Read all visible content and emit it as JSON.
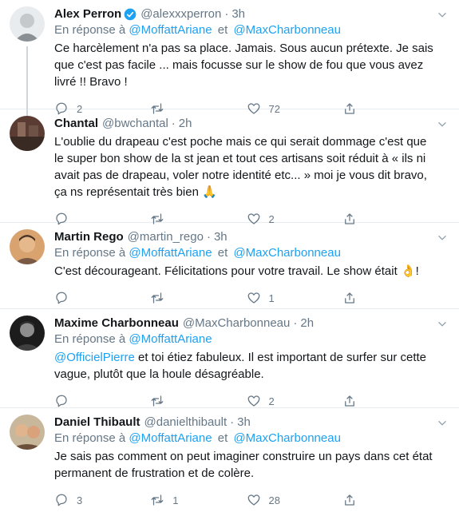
{
  "tweets": [
    {
      "name": "Alex Perron",
      "verified": true,
      "handle": "@alexxxperron",
      "time": "3h",
      "reply_prefix": "En réponse à",
      "reply_to_1": "@MoffattAriane",
      "reply_sep": "et",
      "reply_to_2": "@MaxCharbonneau",
      "text": "Ce harcèlement n'a pas sa place. Jamais. Sous aucun prétexte. Je sais que c'est pas facile ... mais focusse sur le show de fou que vous avez livré !! Bravo !",
      "reply_count": "2",
      "retweet_count": "",
      "like_count": "72"
    },
    {
      "name": "Chantal",
      "handle": "@bwchantal",
      "time": "2h",
      "text": "L'oublie du drapeau c'est poche mais ce qui serait dommage c'est que le super bon show de la st jean et tout ces artisans soit réduit à « ils ni avait pas de drapeau, voler notre identité etc... » moi je vous dit bravo, ça ns représentait très bien",
      "emoji": "🙏",
      "reply_count": "",
      "retweet_count": "",
      "like_count": "2"
    },
    {
      "name": "Martin Rego",
      "handle": "@martin_rego",
      "time": "3h",
      "reply_prefix": "En réponse à",
      "reply_to_1": "@MoffattAriane",
      "reply_sep": "et",
      "reply_to_2": "@MaxCharbonneau",
      "text": "C'est décourageant. Félicitations pour votre travail. Le show était",
      "emoji": "👌",
      "text_end": "!",
      "reply_count": "",
      "retweet_count": "",
      "like_count": "1"
    },
    {
      "name": "Maxime Charbonneau",
      "handle": "@MaxCharbonneau",
      "time": "2h",
      "reply_prefix": "En réponse à",
      "reply_to_1": "@MoffattAriane",
      "mention": "@OfficielPierre",
      "text": "et toi étiez fabuleux. Il est important de surfer sur cette vague, plutôt que la houle désagréable.",
      "reply_count": "",
      "retweet_count": "",
      "like_count": "2"
    },
    {
      "name": "Daniel Thibault",
      "handle": "@danielthibault",
      "time": "3h",
      "reply_prefix": "En réponse à",
      "reply_to_1": "@MoffattAriane",
      "reply_sep": "et",
      "reply_to_2": "@MaxCharbonneau",
      "text": "Je sais pas comment on peut imaginer construire un pays dans cet état permanent de frustration et de colère.",
      "reply_count": "3",
      "retweet_count": "1",
      "like_count": "28"
    }
  ],
  "colors": {
    "link": "#1da1f2",
    "muted": "#657786",
    "text": "#14171a",
    "divider": "#e6ecf0",
    "verified": "#1da1f2"
  },
  "icons": {
    "reply": "reply-icon",
    "retweet": "retweet-icon",
    "like": "like-icon",
    "share": "share-icon",
    "caret": "chevron-down-icon",
    "verified": "verified-badge-icon"
  }
}
